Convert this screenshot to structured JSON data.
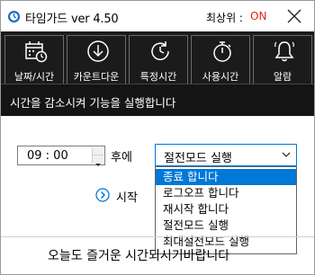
{
  "window": {
    "title": "타임가드 ver 4.50",
    "topmost_label": "최상위 :",
    "topmost_value": "ON"
  },
  "toolbar": {
    "items": [
      {
        "label": "날짜/시간",
        "icon": "calendar-clock-icon"
      },
      {
        "label": "카운트다운",
        "icon": "download-countdown-icon"
      },
      {
        "label": "특정시간",
        "icon": "clock-refresh-icon"
      },
      {
        "label": "사용시간",
        "icon": "stopwatch-icon"
      },
      {
        "label": "알람",
        "icon": "bell-icon"
      }
    ]
  },
  "description": "시간을 감소시켜 기능을 실행합니다",
  "time_entry": {
    "value": "09 : 00",
    "after_label": "후에"
  },
  "action_select": {
    "selected": "절전모드 실행",
    "options": [
      "종료 합니다",
      "로그오프 합니다",
      "재시작 합니다",
      "절전모드 실행",
      "최대절전모드 실행"
    ],
    "highlighted_index": 0
  },
  "start_label": "시작",
  "bottom_message": "오늘도 즐거운 시간되시기바랍니다",
  "colors": {
    "accent": "#0078d7",
    "toolbar_bg": "#1b1b1b",
    "on_status": "#e1261c"
  }
}
